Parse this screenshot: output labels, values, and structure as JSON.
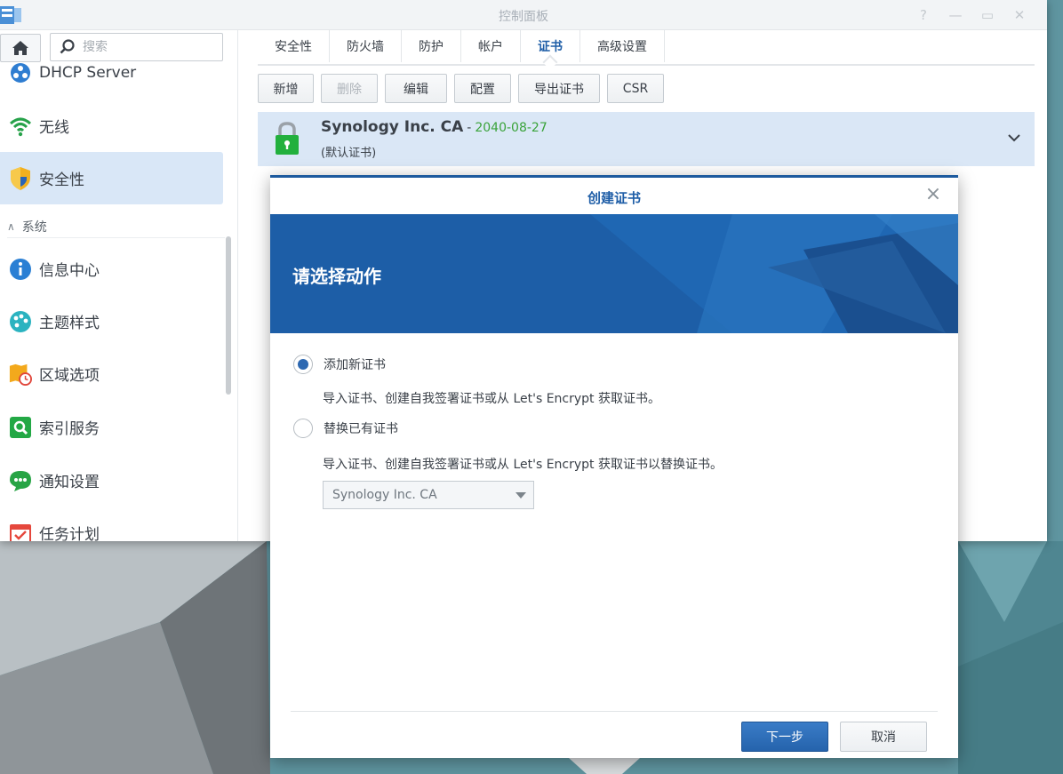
{
  "window": {
    "title": "控制面板",
    "controls": [
      "help-icon",
      "minimize-icon",
      "maximize-icon",
      "close-icon"
    ]
  },
  "sidebar": {
    "search_placeholder": "搜索",
    "items": [
      {
        "label": "DHCP Server",
        "icon": "dhcp-icon"
      },
      {
        "label": "无线",
        "icon": "wifi-icon"
      },
      {
        "label": "安全性",
        "icon": "shield-icon",
        "active": true
      }
    ],
    "section": "系统",
    "system_items": [
      {
        "label": "信息中心",
        "icon": "info-icon"
      },
      {
        "label": "主题样式",
        "icon": "palette-icon"
      },
      {
        "label": "区域选项",
        "icon": "region-icon"
      },
      {
        "label": "索引服务",
        "icon": "index-icon"
      },
      {
        "label": "通知设置",
        "icon": "notification-icon"
      },
      {
        "label": "任务计划",
        "icon": "calendar-icon"
      }
    ]
  },
  "tabs": [
    "安全性",
    "防火墙",
    "防护",
    "帐户",
    "证书",
    "高级设置"
  ],
  "active_tab": "证书",
  "toolbar": {
    "new": "新增",
    "delete": "删除",
    "edit": "编辑",
    "configure": "配置",
    "export": "导出证书",
    "csr": "CSR"
  },
  "certificate": {
    "name": "Synology Inc. CA",
    "separator": "-",
    "expiry": "2040-08-27",
    "note": "(默认证书)"
  },
  "dialog": {
    "title": "创建证书",
    "banner_title": "请选择动作",
    "option_add": "添加新证书",
    "option_add_desc": "导入证书、创建自我签署证书或从 Let's Encrypt 获取证书。",
    "option_replace": "替换已有证书",
    "option_replace_desc": "导入证书、创建自我签署证书或从 Let's Encrypt 获取证书以替换证书。",
    "select_value": "Synology Inc. CA",
    "next": "下一步",
    "cancel": "取消"
  },
  "colors": {
    "accent": "#1f5ea7",
    "active_row": "#dae7f6",
    "date_green": "#3aa33a"
  }
}
